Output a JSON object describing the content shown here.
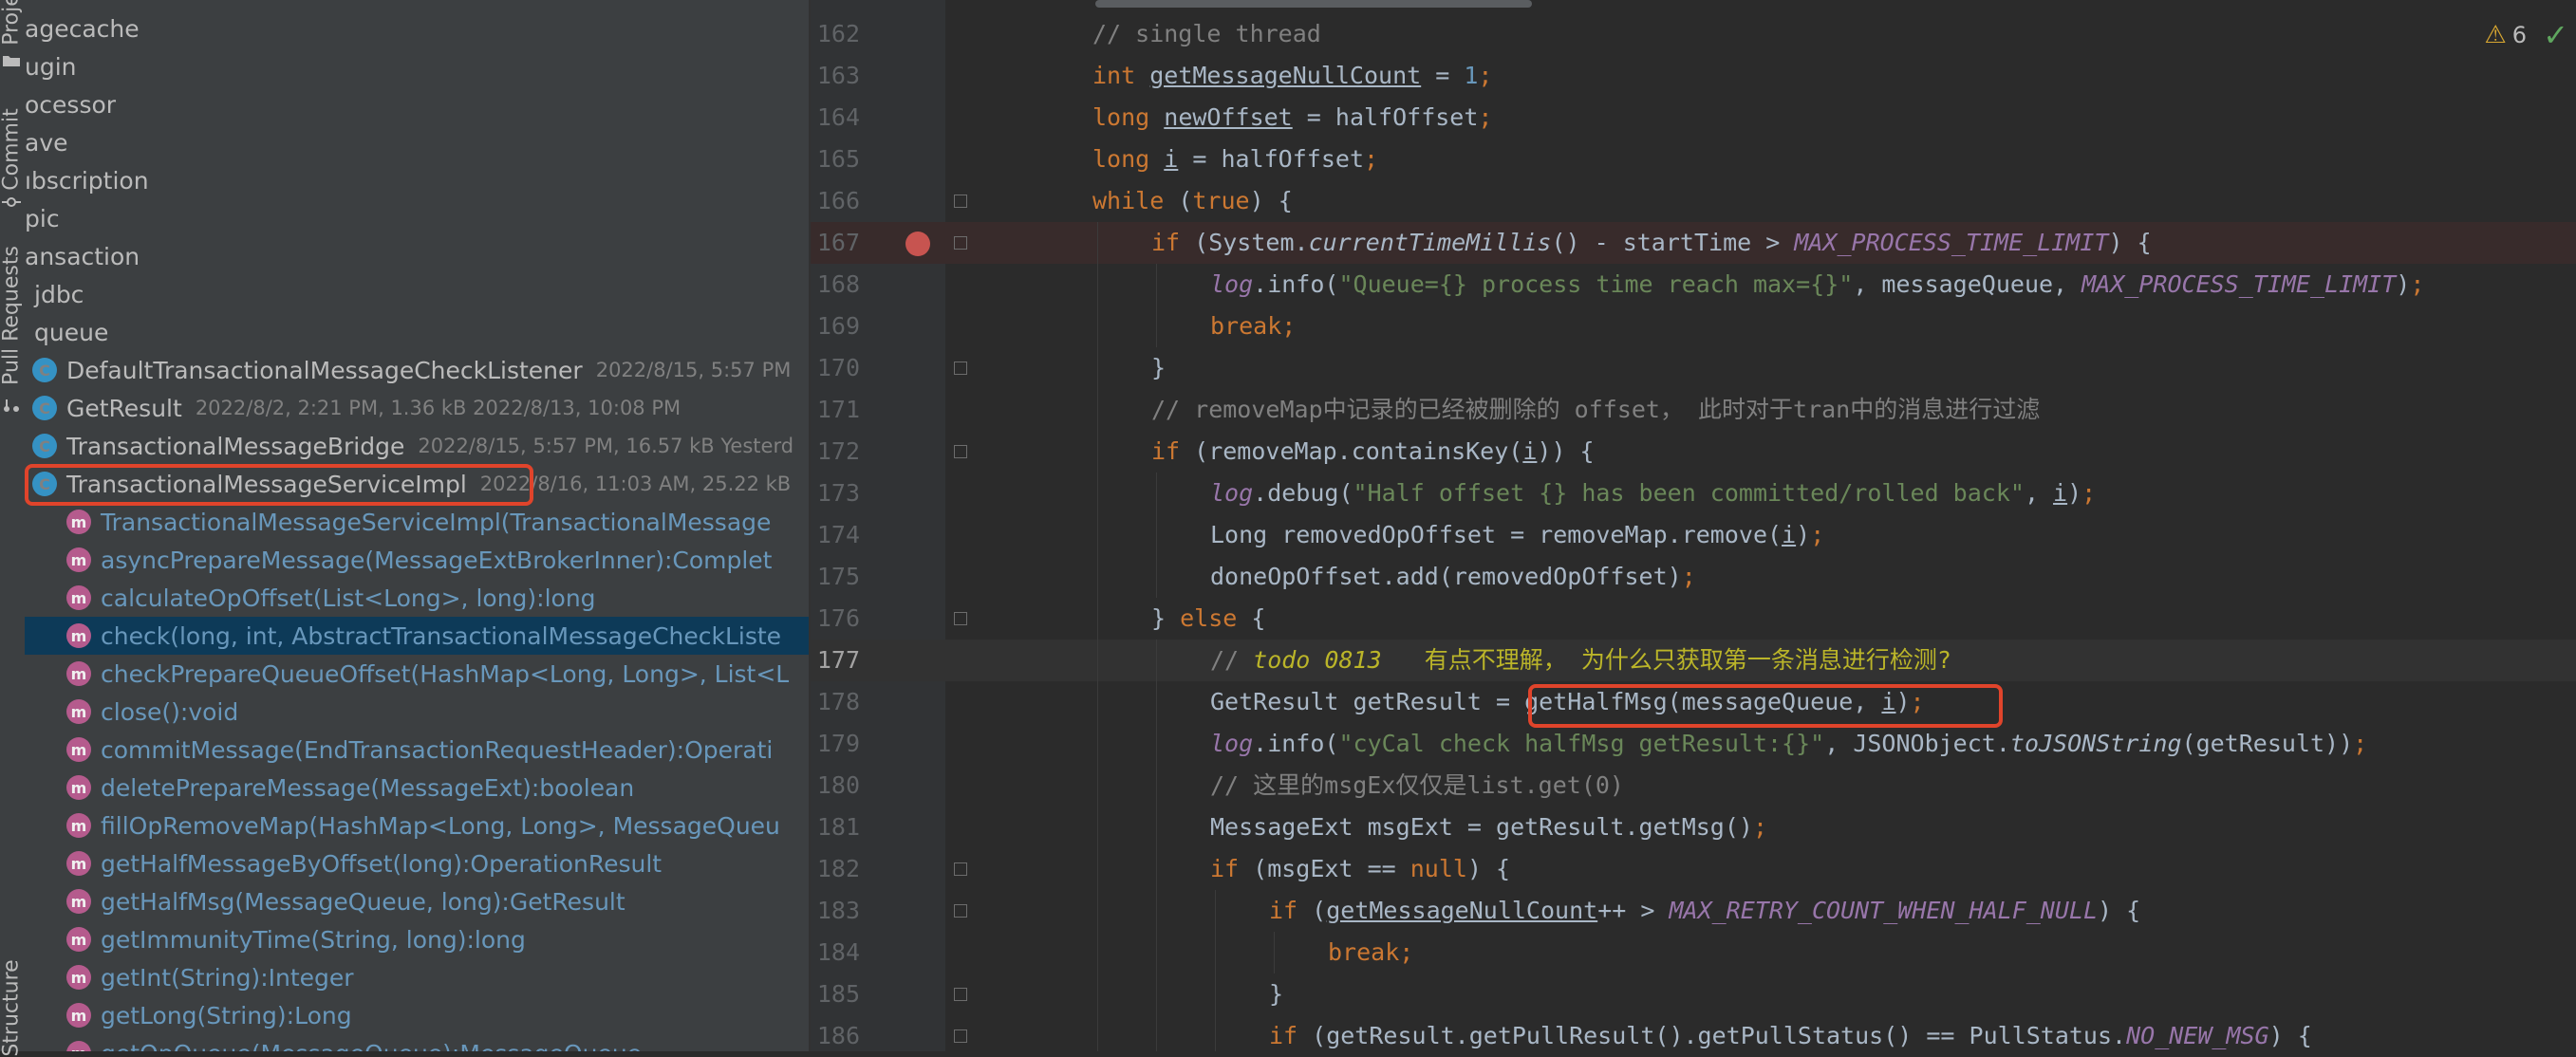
{
  "side_strip": {
    "tabs": [
      "Proje",
      "Commit",
      "Pull Requests",
      "Structure"
    ]
  },
  "project_tree": {
    "rows": [
      {
        "label": "agecache",
        "kind": "folder",
        "meta": ""
      },
      {
        "label": "ugin",
        "kind": "folder",
        "meta": ""
      },
      {
        "label": "ocessor",
        "kind": "folder",
        "meta": ""
      },
      {
        "label": "ave",
        "kind": "folder",
        "meta": ""
      },
      {
        "label": "ıbscription",
        "kind": "folder",
        "meta": ""
      },
      {
        "label": "pic",
        "kind": "folder",
        "meta": ""
      },
      {
        "label": "ansaction",
        "kind": "folder",
        "meta": ""
      },
      {
        "label": "jdbc",
        "kind": "folder",
        "meta": ""
      },
      {
        "label": "queue",
        "kind": "folder",
        "meta": ""
      },
      {
        "label": "DefaultTransactionalMessageCheckListener",
        "kind": "class",
        "meta": "2022/8/15, 5:57 PM"
      },
      {
        "label": "GetResult",
        "kind": "class",
        "meta": "2022/8/2, 2:21 PM, 1.36 kB 2022/8/13, 10:08 PM"
      },
      {
        "label": "TransactionalMessageBridge",
        "kind": "class",
        "meta": "2022/8/15, 5:57 PM, 16.57 kB Yesterd"
      },
      {
        "label": "TransactionalMessageServiceImpl",
        "kind": "class",
        "meta": "2022/8/16, 11:03 AM, 25.22 kB"
      },
      {
        "label": "TransactionalMessageServiceImpl(TransactionalMessage",
        "kind": "method",
        "meta": ""
      },
      {
        "label": "asyncPrepareMessage(MessageExtBrokerInner):Complet",
        "kind": "method",
        "meta": ""
      },
      {
        "label": "calculateOpOffset(List<Long>, long):long",
        "kind": "method",
        "meta": ""
      },
      {
        "label": "check(long, int, AbstractTransactionalMessageCheckListe",
        "kind": "method",
        "meta": ""
      },
      {
        "label": "checkPrepareQueueOffset(HashMap<Long, Long>, List<L",
        "kind": "method",
        "meta": ""
      },
      {
        "label": "close():void",
        "kind": "method",
        "meta": ""
      },
      {
        "label": "commitMessage(EndTransactionRequestHeader):Operati",
        "kind": "method",
        "meta": ""
      },
      {
        "label": "deletePrepareMessage(MessageExt):boolean",
        "kind": "method",
        "meta": ""
      },
      {
        "label": "fillOpRemoveMap(HashMap<Long, Long>, MessageQueu",
        "kind": "method",
        "meta": ""
      },
      {
        "label": "getHalfMessageByOffset(long):OperationResult",
        "kind": "method",
        "meta": ""
      },
      {
        "label": "getHalfMsg(MessageQueue, long):GetResult",
        "kind": "method",
        "meta": ""
      },
      {
        "label": "getImmunityTime(String, long):long",
        "kind": "method",
        "meta": ""
      },
      {
        "label": "getInt(String):Integer",
        "kind": "method",
        "meta": ""
      },
      {
        "label": "getLong(String):Long",
        "kind": "method",
        "meta": ""
      },
      {
        "label": "getOpQueue(MessageQueue):MessageQueue",
        "kind": "method",
        "meta": ""
      }
    ],
    "selected_index": 16,
    "badge_class": "C",
    "badge_method": "m"
  },
  "editor": {
    "warnings_count": "6",
    "lines": [
      {
        "num": "162",
        "indent": 0,
        "parts": [
          [
            "c",
            "// single thread"
          ]
        ]
      },
      {
        "num": "163",
        "indent": 0,
        "parts": [
          [
            "k",
            "int "
          ],
          [
            "u",
            "getMessageNullCount"
          ],
          [
            "",
            " = "
          ],
          [
            "n",
            "1"
          ],
          [
            "k",
            ";"
          ]
        ]
      },
      {
        "num": "164",
        "indent": 0,
        "parts": [
          [
            "k",
            "long "
          ],
          [
            "u",
            "newOffset"
          ],
          [
            "",
            " = halfOffset"
          ],
          [
            "k",
            ";"
          ]
        ]
      },
      {
        "num": "165",
        "indent": 0,
        "parts": [
          [
            "k",
            "long "
          ],
          [
            "u",
            "i"
          ],
          [
            "",
            " = halfOffset"
          ],
          [
            "k",
            ";"
          ]
        ]
      },
      {
        "num": "166",
        "indent": 0,
        "parts": [
          [
            "k",
            "while "
          ],
          [
            "",
            "("
          ],
          [
            "k",
            "true"
          ],
          [
            "",
            ") {"
          ]
        ]
      },
      {
        "num": "167",
        "indent": 1,
        "parts": [
          [
            "k",
            "if "
          ],
          [
            "",
            "(System."
          ],
          [
            "i",
            "currentTimeMillis"
          ],
          [
            "",
            "() - startTime > "
          ],
          [
            "f",
            "MAX_PROCESS_TIME_LIMIT"
          ],
          [
            "",
            ") {"
          ]
        ]
      },
      {
        "num": "168",
        "indent": 2,
        "parts": [
          [
            "f",
            "log"
          ],
          [
            "",
            ".info("
          ],
          [
            "s",
            "\"Queue={} process time reach max={}\""
          ],
          [
            "",
            ", messageQueue, "
          ],
          [
            "f",
            "MAX_PROCESS_TIME_LIMIT"
          ],
          [
            "",
            ")"
          ],
          [
            "k",
            ";"
          ]
        ]
      },
      {
        "num": "169",
        "indent": 2,
        "parts": [
          [
            "k",
            "break;"
          ]
        ]
      },
      {
        "num": "170",
        "indent": 1,
        "parts": [
          [
            "",
            "}"
          ]
        ]
      },
      {
        "num": "171",
        "indent": 1,
        "parts": [
          [
            "c",
            "// removeMap中记录的已经被删除的 offset， 此时对于tran中的消息进行过滤"
          ]
        ]
      },
      {
        "num": "172",
        "indent": 1,
        "parts": [
          [
            "k",
            "if "
          ],
          [
            "",
            "(removeMap.containsKey("
          ],
          [
            "u",
            "i"
          ],
          [
            "",
            ")) {"
          ]
        ]
      },
      {
        "num": "173",
        "indent": 2,
        "parts": [
          [
            "f",
            "log"
          ],
          [
            "",
            ".debug("
          ],
          [
            "s",
            "\"Half offset {} has been committed/rolled back\""
          ],
          [
            "",
            ", "
          ],
          [
            "u",
            "i"
          ],
          [
            "",
            ")"
          ],
          [
            "k",
            ";"
          ]
        ]
      },
      {
        "num": "174",
        "indent": 2,
        "parts": [
          [
            "",
            "Long removedOpOffset = removeMap.remove("
          ],
          [
            "u",
            "i"
          ],
          [
            "",
            ")"
          ],
          [
            "k",
            ";"
          ]
        ]
      },
      {
        "num": "175",
        "indent": 2,
        "parts": [
          [
            "",
            "doneOpOffset.add(removedOpOffset)"
          ],
          [
            "k",
            ";"
          ]
        ]
      },
      {
        "num": "176",
        "indent": 1,
        "parts": [
          [
            "",
            "} "
          ],
          [
            "k",
            "else "
          ],
          [
            "",
            "{"
          ]
        ]
      },
      {
        "num": "177",
        "indent": 2,
        "parts": [
          [
            "c",
            "// "
          ],
          [
            "td",
            "todo 0813"
          ],
          [
            "tdz",
            "   有点不理解， 为什么只获取第一条消息进行检测?"
          ]
        ]
      },
      {
        "num": "178",
        "indent": 2,
        "parts": [
          [
            "",
            "GetResult getResult = getHalfMsg(messageQueue, "
          ],
          [
            "u",
            "i"
          ],
          [
            "",
            ")"
          ],
          [
            "k",
            ";"
          ]
        ]
      },
      {
        "num": "179",
        "indent": 2,
        "parts": [
          [
            "f",
            "log"
          ],
          [
            "",
            ".info("
          ],
          [
            "s",
            "\"cyCal check halfMsg getResult:{}\""
          ],
          [
            "",
            ", JSONObject."
          ],
          [
            "i",
            "toJSONString"
          ],
          [
            "",
            "(getResult))"
          ],
          [
            "k",
            ";"
          ]
        ]
      },
      {
        "num": "180",
        "indent": 2,
        "parts": [
          [
            "c",
            "// 这里的msgEx仅仅是list.get(0)"
          ]
        ]
      },
      {
        "num": "181",
        "indent": 2,
        "parts": [
          [
            "",
            "MessageExt msgExt = getResult.getMsg()"
          ],
          [
            "k",
            ";"
          ]
        ]
      },
      {
        "num": "182",
        "indent": 2,
        "parts": [
          [
            "k",
            "if "
          ],
          [
            "",
            "(msgExt == "
          ],
          [
            "k",
            "null"
          ],
          [
            "",
            ") {"
          ]
        ]
      },
      {
        "num": "183",
        "indent": 3,
        "parts": [
          [
            "k",
            "if "
          ],
          [
            "",
            "("
          ],
          [
            "u",
            "getMessageNullCount"
          ],
          [
            "",
            "++ > "
          ],
          [
            "f",
            "MAX_RETRY_COUNT_WHEN_HALF_NULL"
          ],
          [
            "",
            ") {"
          ]
        ]
      },
      {
        "num": "184",
        "indent": 4,
        "parts": [
          [
            "k",
            "break;"
          ]
        ]
      },
      {
        "num": "185",
        "indent": 3,
        "parts": [
          [
            "",
            "}"
          ]
        ]
      },
      {
        "num": "186",
        "indent": 3,
        "parts": [
          [
            "k",
            "if "
          ],
          [
            "",
            "(getResult.getPullResult().getPullStatus() == PullStatus."
          ],
          [
            "f",
            "NO_NEW_MSG"
          ],
          [
            "",
            ") {"
          ]
        ]
      }
    ],
    "breakpoint_line": "167",
    "current_line": "177",
    "fold_lines": [
      "166",
      "167",
      "170",
      "172",
      "176",
      "182",
      "183",
      "185",
      "186"
    ]
  },
  "colors": {
    "keyword": "#cc7832",
    "comment": "#808080",
    "string": "#6a8759",
    "field": "#9876aa",
    "number": "#6897bb",
    "todo": "#bbb529",
    "annotation_box": "#e0442b"
  }
}
